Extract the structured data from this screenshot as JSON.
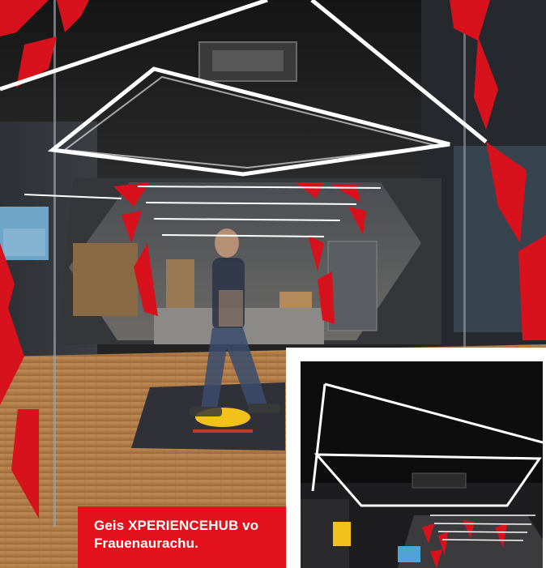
{
  "caption": {
    "text": "Geis XPERIENCEHUB vo Frauenaurachu."
  },
  "brand": {
    "accent_red": "#e3111b",
    "floor_wood": "#b07a45",
    "ceiling_dark": "#1f1f1f",
    "led_light": "#ffffff"
  }
}
